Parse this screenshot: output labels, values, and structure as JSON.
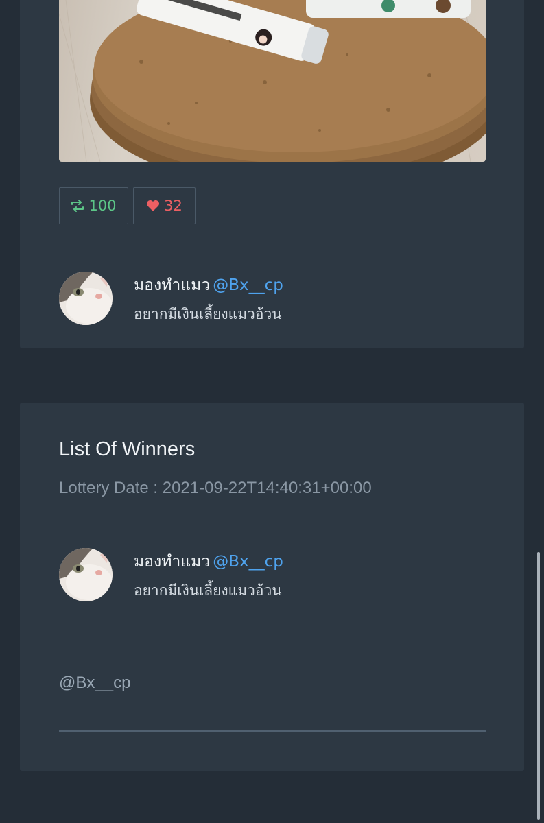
{
  "post": {
    "retweet": {
      "icon": "retweet-icon",
      "count": "100",
      "color": "#5cc587"
    },
    "like": {
      "icon": "heart-icon",
      "count": "32",
      "color": "#ec5f63"
    },
    "user": {
      "name": "มองทำแมว",
      "handle": "@Bx__cp",
      "bio": "อยากมีเงินเลี้ยงแมวอ้วน"
    }
  },
  "winners": {
    "title": "List Of Winners",
    "lottery_date": "Lottery Date : 2021-09-22T14:40:31+00:00",
    "user": {
      "name": "มองทำแมว",
      "handle": "@Bx__cp",
      "bio": "อยากมีเงินเลี้ยงแมวอ้วน"
    },
    "mention": "@Bx__cp"
  },
  "colors": {
    "background": "#242d37",
    "card": "#2d3843",
    "link": "#4fa3ee"
  }
}
